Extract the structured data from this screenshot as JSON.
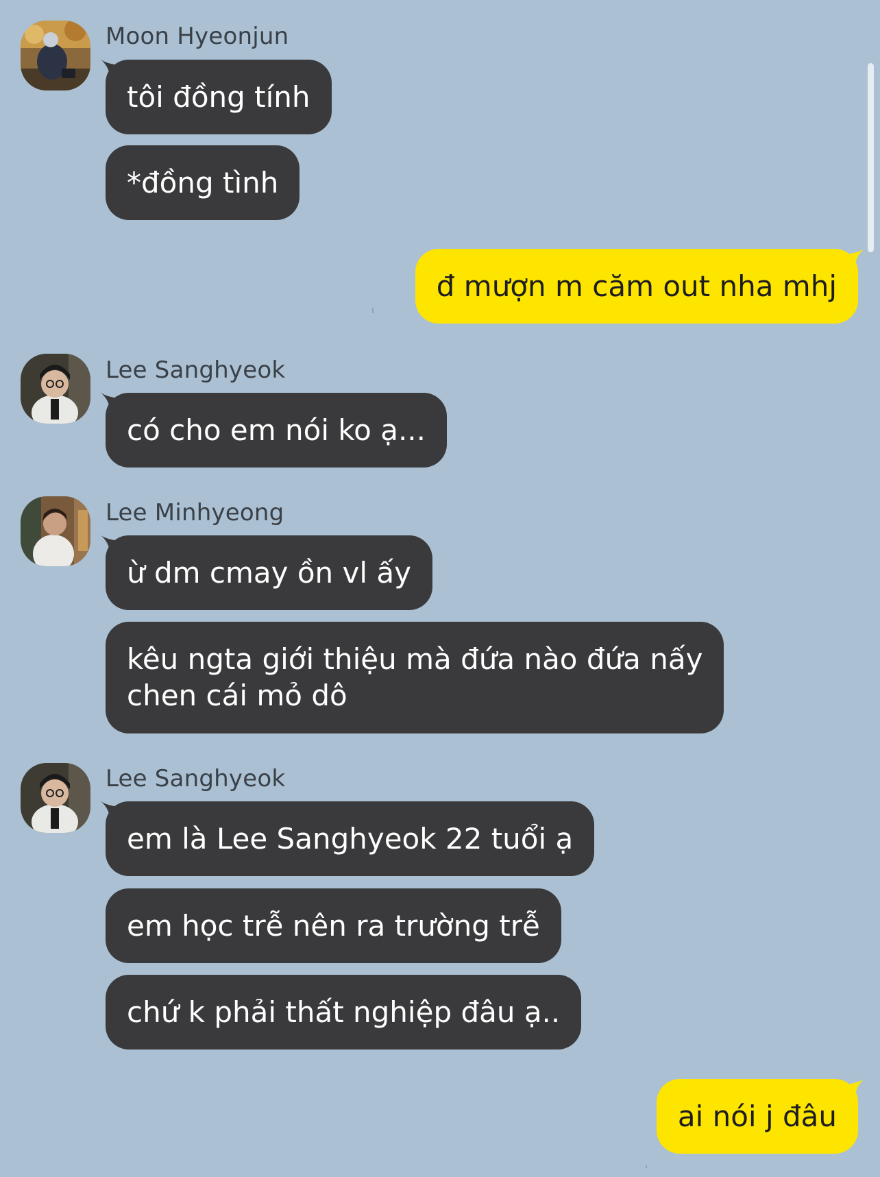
{
  "colors": {
    "background": "#abc1d3",
    "incoming_bubble": "#3a3a3c",
    "outgoing_bubble": "#fee500",
    "incoming_text": "#ffffff",
    "outgoing_text": "#1d1d1f",
    "sender_name": "#3a4047"
  },
  "messages": {
    "group1": {
      "sender": "Moon Hyeonjun",
      "avatar": "moon-hyeonjun-avatar",
      "lines": [
        "tôi đồng tính",
        "*đồng tình"
      ]
    },
    "out1": {
      "text": "đ mượn m căm out nha mhj"
    },
    "group2": {
      "sender": "Lee Sanghyeok",
      "avatar": "lee-sanghyeok-avatar",
      "lines": [
        "có cho em nói ko ạ..."
      ]
    },
    "group3": {
      "sender": "Lee Minhyeong",
      "avatar": "lee-minhyeong-avatar",
      "lines": [
        "ừ dm cmay ồn vl ấy"
      ],
      "multiline": [
        "kêu ngta giới thiệu mà đứa nào đứa nấy",
        "chen cái mỏ dô"
      ]
    },
    "group4": {
      "sender": "Lee Sanghyeok",
      "avatar": "lee-sanghyeok-avatar",
      "lines": [
        "em là Lee Sanghyeok 22 tuổi ạ",
        "em học trễ nên ra trường trễ",
        "chứ k phải thất nghiệp đâu ạ.."
      ]
    },
    "out2": {
      "text": "ai nói j đâu"
    }
  }
}
